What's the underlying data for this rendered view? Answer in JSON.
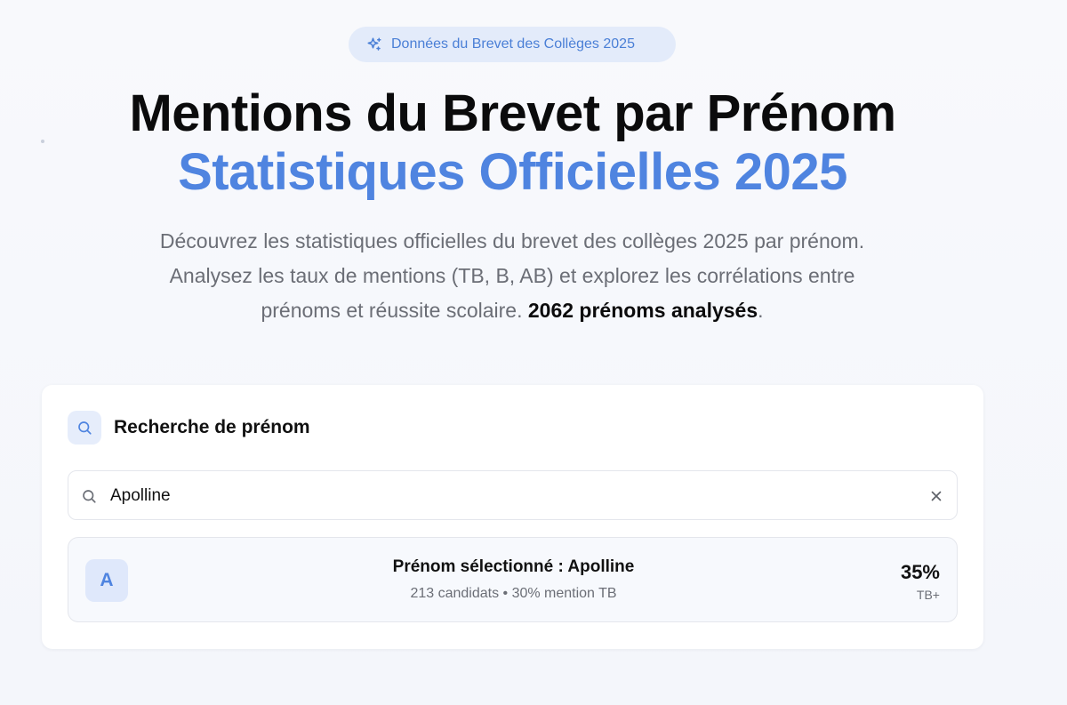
{
  "badge": {
    "icon": "sparkles-icon",
    "label": "Données du Brevet des Collèges 2025"
  },
  "hero": {
    "title": "Mentions du Brevet par Prénom",
    "subtitle": "Statistiques Officielles 2025",
    "description": "Découvrez les statistiques officielles du brevet des collèges 2025 par prénom. Analysez les taux de mentions (TB, B, AB) et explorez les corrélations entre prénoms et réussite scolaire. ",
    "count_highlight": "2062 prénoms analysés",
    "trailing": "."
  },
  "search_card": {
    "icon": "search-icon",
    "title": "Recherche de prénom",
    "input_value": "Apolline",
    "clear_icon": "close-icon"
  },
  "result": {
    "avatar_letter": "A",
    "title": "Prénom sélectionné : Apolline",
    "subtitle": "213 candidats • 30% mention TB",
    "percentage": "35%",
    "percentage_label": "TB+"
  },
  "colors": {
    "accent": "#4f84e0",
    "badge_bg": "#e3ebfa",
    "text": "#0b0b0c",
    "muted": "#6b6e76"
  }
}
